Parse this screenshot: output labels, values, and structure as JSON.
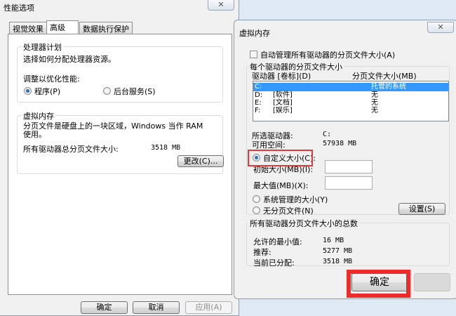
{
  "perf_window": {
    "title": "性能选项",
    "close": "✕",
    "tabs": [
      "视觉效果",
      "高级",
      "数据执行保护"
    ],
    "cpu": {
      "title": "处理器计划",
      "desc": "选择如何分配处理器资源。",
      "adjust": "调整以优化性能:",
      "opt_programs": "程序(P)",
      "opt_services": "后台服务(S)"
    },
    "vm": {
      "title": "虚拟内存",
      "desc": "分页文件是硬盘上的一块区域，Windows 当作 RAM 使用。",
      "total_label": "所有驱动器总分页文件大小:",
      "total_value": "3518 MB",
      "change": "更改(C)..."
    },
    "buttons": {
      "ok": "确定",
      "cancel": "取消",
      "apply": "应用(A)"
    }
  },
  "vm_window": {
    "title": "虚拟内存",
    "close": "✕",
    "auto_manage": "自动管理所有驱动器的分页文件大小(A)",
    "per_drive_title": "每个驱动器的分页文件大小",
    "col_drive": "驱动器 [卷标](D)",
    "col_size": "分页文件大小(MB)",
    "drives": [
      {
        "drive": "C:",
        "label": "",
        "size": "托管的系统"
      },
      {
        "drive": "D:",
        "label": "[软件]",
        "size": "无"
      },
      {
        "drive": "E:",
        "label": "[文档]",
        "size": "无"
      },
      {
        "drive": "F:",
        "label": "[娱乐]",
        "size": "无"
      }
    ],
    "selected_drive_label": "所选驱动器:",
    "selected_drive": "C:",
    "free_space_label": "可用空间:",
    "free_space": "57938 MB",
    "custom_size": "自定义大小(C):",
    "initial_size": "初始大小(MB)(I):",
    "initial_value": "",
    "max_size": "最大值(MB)(X):",
    "max_value": "",
    "system_managed": "系统管理的大小(Y)",
    "no_paging": "无分页文件(N)",
    "set": "设置(S)",
    "totals_title": "所有驱动器分页文件大小的总数",
    "min_label": "允许的最小值:",
    "min_value": "16 MB",
    "rec_label": "推荐:",
    "rec_value": "5277 MB",
    "cur_label": "当前已分配:",
    "cur_value": "3518 MB",
    "ok": "确定"
  }
}
